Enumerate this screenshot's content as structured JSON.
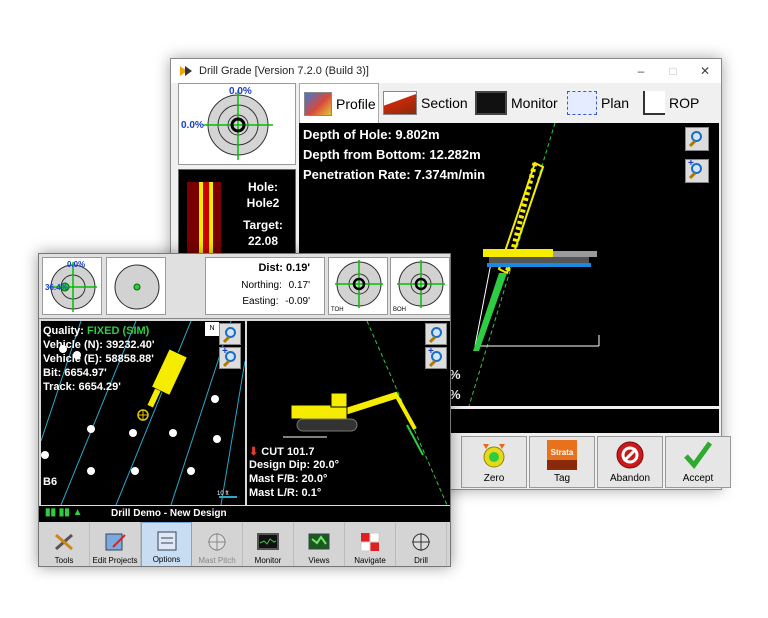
{
  "back_window": {
    "title": "Drill Grade [Version 7.2.0 (Build 3)]",
    "controls": {
      "minimize": "–",
      "maximize": "□",
      "close": "✕"
    },
    "scope": {
      "top_value": "0.0%",
      "left_value": "0.0%"
    },
    "hole_panel": {
      "hole_label": "Hole:",
      "hole_name": "Hole2",
      "target_label": "Target:",
      "target_value": "22.08"
    },
    "tabs": [
      {
        "label": "Profile",
        "icon": "profile-icon"
      },
      {
        "label": "Section",
        "icon": "section-icon"
      },
      {
        "label": "Monitor",
        "icon": "monitor-icon"
      },
      {
        "label": "Plan",
        "icon": "plan-icon"
      },
      {
        "label": "ROP",
        "icon": "rop-icon"
      }
    ],
    "readouts": {
      "depth_of_hole": "Depth of Hole: 9.802m",
      "depth_from_bottom": "Depth from Bottom: 12.282m",
      "penetration_rate": "Penetration Rate: 7.374m/min"
    },
    "edge_glyph": "%",
    "actions": [
      {
        "label": "Zero",
        "icon": "zero-icon"
      },
      {
        "label": "Tag",
        "icon": "strata-tag-icon",
        "icon_text": "Strata"
      },
      {
        "label": "Abandon",
        "icon": "abandon-icon"
      },
      {
        "label": "Accept",
        "icon": "accept-check-icon"
      }
    ]
  },
  "front_window": {
    "scope_left": {
      "top_value": "0.0%",
      "left_value": "36.4%"
    },
    "dist_panel": {
      "dist_label": "Dist:",
      "dist_value": "0.19'",
      "northing_label": "Northing:",
      "northing_value": "0.17'",
      "easting_label": "Easting:",
      "easting_value": "-0.09'"
    },
    "toh_label": "TOH",
    "boh_label": "BOH",
    "map": {
      "quality_label": "Quality:",
      "quality_value": "FIXED (SIM)",
      "vehicle_n": "Vehicle (N): 39232.40'",
      "vehicle_e": "Vehicle (E): 58858.88'",
      "bit": "Bit: 6654.97'",
      "track": "Track: 6654.29'",
      "grid_label": "B6",
      "scale_label": "10 ft",
      "north_label": "N"
    },
    "side": {
      "cut": "CUT 101.7",
      "design_dip": "Design Dip: 20.0°",
      "mast_fb": "Mast F/B: 20.0°",
      "mast_lr": "Mast L/R: 0.1°"
    },
    "status_title": "Drill Demo - New Design",
    "nav": [
      {
        "label": "Tools",
        "icon": "tools-icon"
      },
      {
        "label": "Edit Projects",
        "icon": "edit-projects-icon"
      },
      {
        "label": "Options",
        "icon": "options-icon"
      },
      {
        "label": "Mast Pitch",
        "icon": "mast-pitch-icon"
      },
      {
        "label": "Monitor",
        "icon": "monitor-icon"
      },
      {
        "label": "Views",
        "icon": "views-icon"
      },
      {
        "label": "Navigate",
        "icon": "navigate-icon"
      },
      {
        "label": "Drill",
        "icon": "drill-icon"
      }
    ]
  },
  "colors": {
    "accent_green": "#2ecc40",
    "boom_yellow": "#f5ec00",
    "scope_blue": "#1a3ec8",
    "abandon_red": "#cc1a1a",
    "strata_orange": "#e8711c"
  }
}
